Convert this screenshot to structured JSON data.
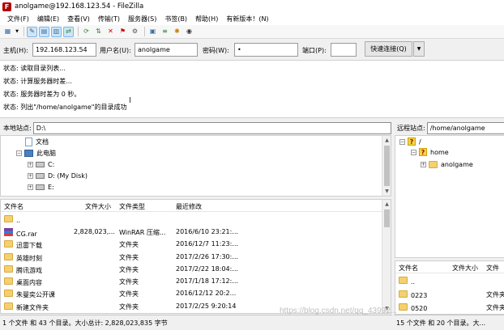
{
  "window": {
    "title": "anolgame@192.168.123.54 - FileZilla",
    "icon_letter": "F"
  },
  "menu": [
    "文件(F)",
    "编辑(E)",
    "查看(V)",
    "传输(T)",
    "服务器(S)",
    "书签(B)",
    "帮助(H)",
    "有新版本！(N)"
  ],
  "toolbar": {
    "icons": [
      "site-manager-icon",
      "toggle-log-icon",
      "toggle-local-tree-icon",
      "toggle-remote-tree-icon",
      "toggle-queue-icon",
      "refresh-icon",
      "process-queue-icon",
      "cancel-icon",
      "disconnect-icon",
      "reconnect-icon",
      "filter-icon",
      "compare-icon",
      "sync-browse-icon",
      "search-icon"
    ]
  },
  "quickconnect": {
    "host_label": "主机(H):",
    "host_value": "192.168.123.54",
    "user_label": "用户名(U):",
    "user_value": "anolgame",
    "pass_label": "密码(W):",
    "pass_value": "•",
    "port_label": "端口(P):",
    "port_value": "",
    "connect_label": "快速连接(Q)",
    "dropdown_glyph": "▼"
  },
  "log": [
    "状态:  读取目录列表...",
    "状态:  计算服务器时差...",
    "状态:  服务器时差为 0 秒。",
    "状态:  列出\"/home/anolgame\"的目录成功"
  ],
  "local": {
    "site_label": "本地站点:",
    "path": "D:\\",
    "tree": [
      {
        "label": "文档",
        "icon": "document-icon"
      },
      {
        "label": "此电脑",
        "icon": "computer-icon",
        "expander": "−"
      },
      {
        "label": "C:",
        "icon": "drive-icon",
        "expander": "+"
      },
      {
        "label": "D: (My Disk)",
        "icon": "drive-icon",
        "expander": "+"
      },
      {
        "label": "E:",
        "icon": "drive-icon",
        "expander": "+"
      }
    ],
    "columns": [
      "文件名",
      "文件大小",
      "文件类型",
      "最近修改"
    ],
    "files": [
      {
        "name": "..",
        "size": "",
        "type": "",
        "modified": "",
        "icon": "folder-icon"
      },
      {
        "name": "CG.rar",
        "size": "2,828,023,...",
        "type": "WinRAR 压缩...",
        "modified": "2016/6/10 23:21:...",
        "icon": "rar-icon"
      },
      {
        "name": "迅雷下载",
        "size": "",
        "type": "文件夹",
        "modified": "2016/12/7 11:23:...",
        "icon": "folder-icon"
      },
      {
        "name": "英雄时刻",
        "size": "",
        "type": "文件夹",
        "modified": "2017/2/26 17:30:...",
        "icon": "folder-icon"
      },
      {
        "name": "腾讯游戏",
        "size": "",
        "type": "文件夹",
        "modified": "2017/2/22 18:04:...",
        "icon": "folder-icon"
      },
      {
        "name": "桌面内容",
        "size": "",
        "type": "文件夹",
        "modified": "2017/1/18 17:12:...",
        "icon": "folder-icon"
      },
      {
        "name": "朱曼奕公开课",
        "size": "",
        "type": "文件夹",
        "modified": "2016/12/12 20:2...",
        "icon": "folder-icon"
      },
      {
        "name": "新建文件夹",
        "size": "",
        "type": "文件夹",
        "modified": "2017/2/25 9:20:14",
        "icon": "folder-icon"
      }
    ],
    "status": "1 个文件 和 43 个目录。大小总计: 2,828,023,835 字节"
  },
  "remote": {
    "site_label": "远程站点:",
    "path": "/home/anolgame",
    "tree": [
      {
        "label": "/",
        "icon": "unknown-folder-icon",
        "expander": "−"
      },
      {
        "label": "home",
        "icon": "unknown-folder-icon",
        "expander": "−"
      },
      {
        "label": "anolgame",
        "icon": "folder-icon",
        "expander": "+"
      }
    ],
    "columns": [
      "文件名",
      "文件大小",
      "文件"
    ],
    "files": [
      {
        "name": "..",
        "size": "",
        "type": ""
      },
      {
        "name": "0223",
        "size": "",
        "type": "文件夹"
      },
      {
        "name": "0520",
        "size": "",
        "type": "文件夹"
      }
    ],
    "status": "15 个文件 和 20 个目录。大..."
  },
  "watermark": "https://blog.csdn.net/qq_43992..."
}
